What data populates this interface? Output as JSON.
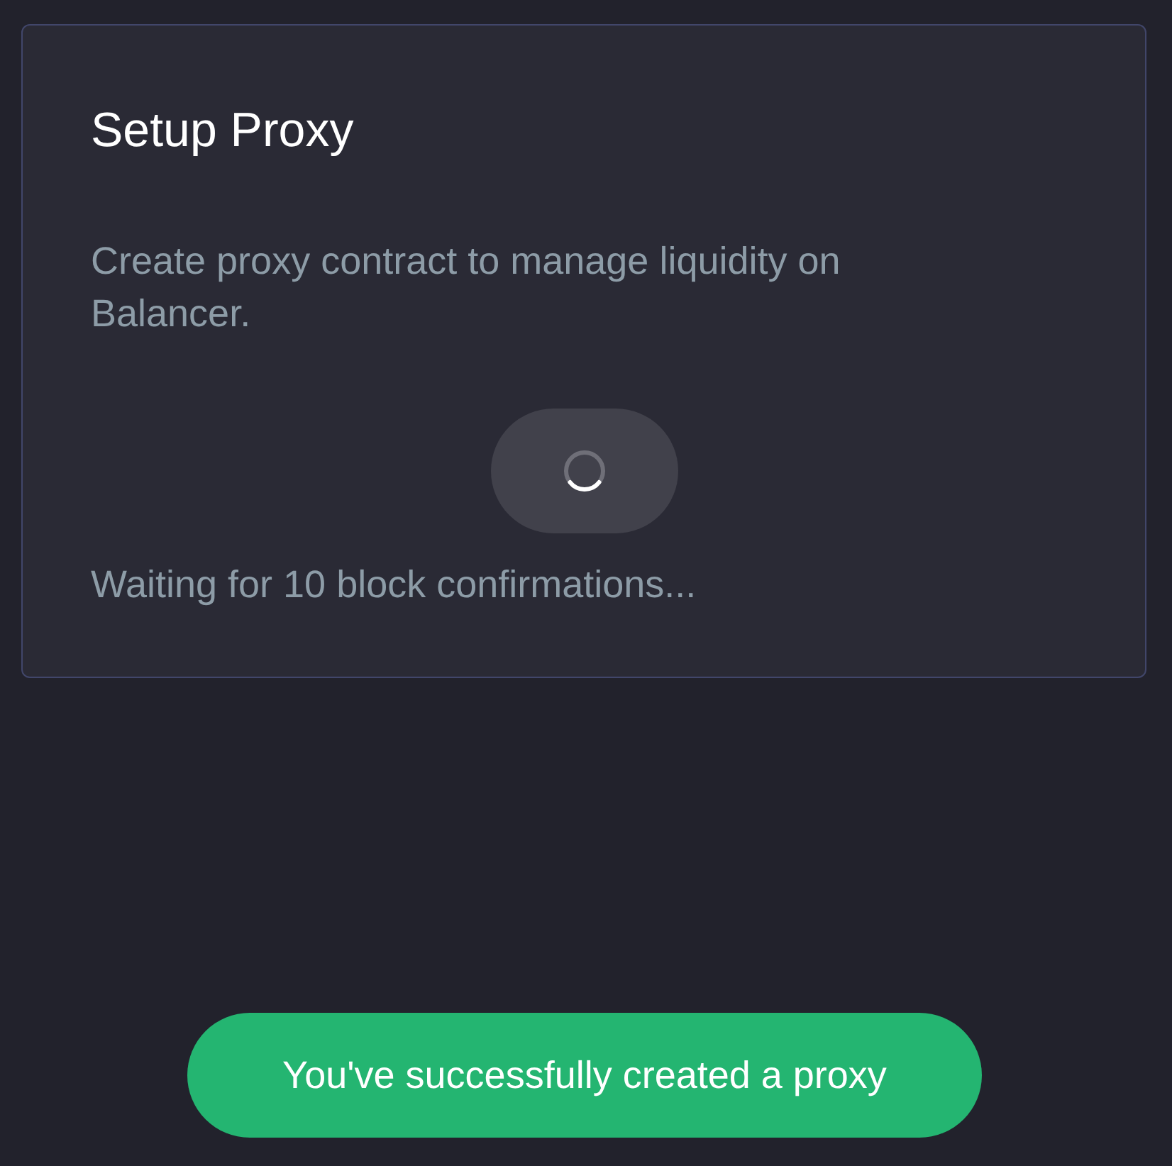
{
  "card": {
    "title": "Setup Proxy",
    "description": "Create proxy contract to manage liquidity on Balancer.",
    "button": {
      "loading": true
    },
    "status": "Waiting for 10 block confirmations..."
  },
  "toast": {
    "kind": "success",
    "message": "You've successfully created a proxy"
  }
}
